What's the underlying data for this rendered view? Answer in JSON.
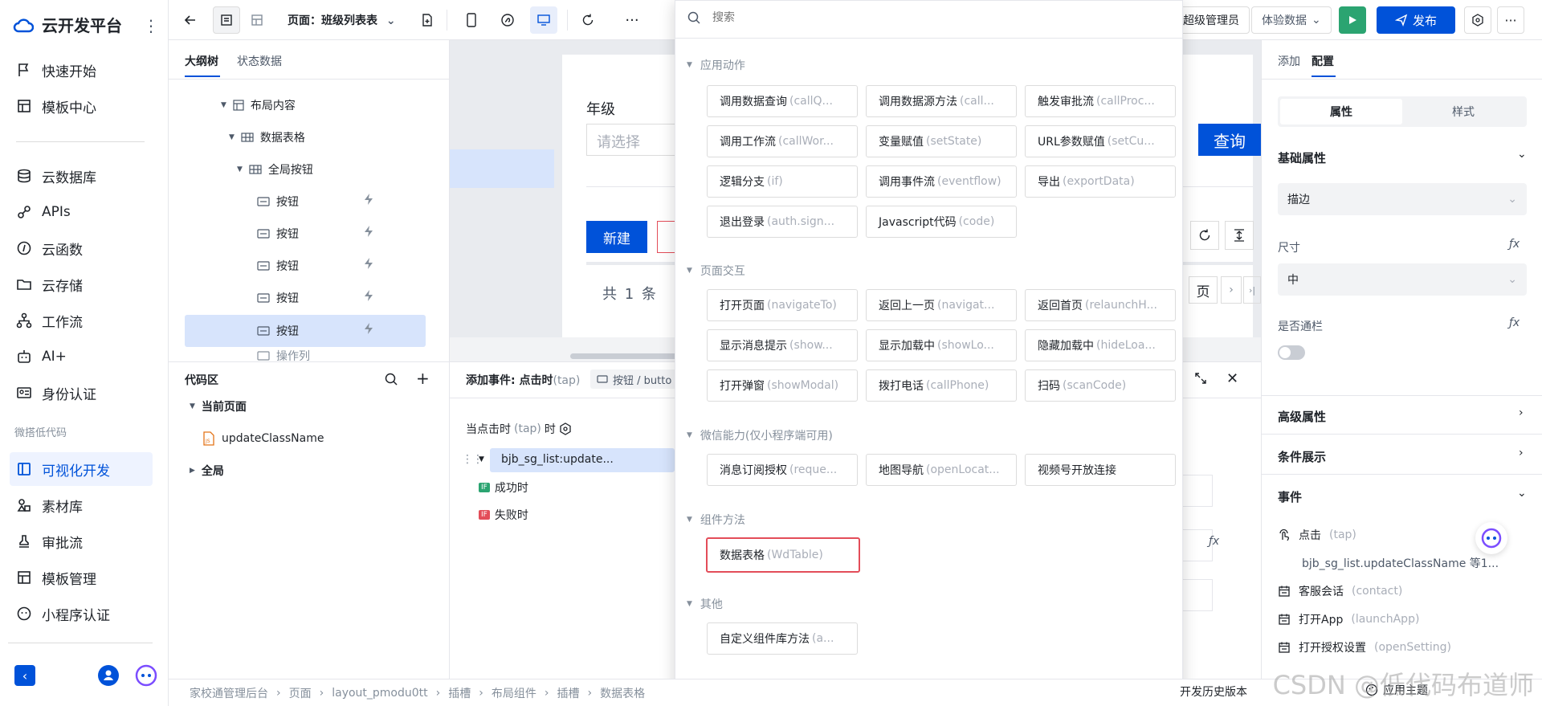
{
  "app": {
    "title": "云开发平台"
  },
  "sidebar": {
    "items": [
      {
        "label": "快速开始",
        "icon": "flag-icon"
      },
      {
        "label": "模板中心",
        "icon": "template-icon"
      },
      {
        "label": "云数据库",
        "icon": "database-icon"
      },
      {
        "label": "APIs",
        "icon": "api-icon"
      },
      {
        "label": "云函数",
        "icon": "function-icon"
      },
      {
        "label": "云存储",
        "icon": "folder-icon"
      },
      {
        "label": "工作流",
        "icon": "workflow-icon"
      },
      {
        "label": "AI+",
        "icon": "robot-icon"
      },
      {
        "label": "身份认证",
        "icon": "id-card-icon"
      }
    ],
    "section_label": "微搭低代码",
    "lowcode_items": [
      {
        "label": "可视化开发",
        "icon": "layout-icon",
        "active": true
      },
      {
        "label": "素材库",
        "icon": "shapes-icon"
      },
      {
        "label": "审批流",
        "icon": "stamp-icon"
      },
      {
        "label": "模板管理",
        "icon": "template-manage-icon"
      },
      {
        "label": "小程序认证",
        "icon": "miniprogram-icon"
      }
    ]
  },
  "toolbar": {
    "page_label": "页面：班级列表表",
    "role_label": "超级管理员",
    "data_label": "体验数据",
    "publish_label": "发布"
  },
  "tree": {
    "tabs": [
      "大纲树",
      "状态数据"
    ],
    "nodes": [
      {
        "label": "布局内容"
      },
      {
        "label": "数据表格"
      },
      {
        "label": "全局按钮"
      },
      {
        "label": "按钮"
      },
      {
        "label": "按钮"
      },
      {
        "label": "按钮"
      },
      {
        "label": "按钮"
      },
      {
        "label": "按钮",
        "selected": true
      },
      {
        "label": "操作列"
      }
    ]
  },
  "code": {
    "title": "代码区",
    "current_page": "当前页面",
    "file": "updateClassName",
    "global": "全局"
  },
  "canvas": {
    "grade_label": "年级",
    "grade_placeholder": "请选择",
    "query_label": "查询",
    "new_label": "新建",
    "total_text": "共 1 条",
    "page_label": "页"
  },
  "event": {
    "title_prefix": "添加事件: 点击时",
    "title_tap": "(tap)",
    "breadcrumb": "按钮 / butto",
    "trigger_prefix": "当点击时",
    "trigger_tap": "(tap)",
    "trigger_suffix": "时",
    "action": "bjb_sg_list:update...",
    "success": "成功时",
    "fail": "失败时",
    "if_label": "IF"
  },
  "dropdown": {
    "search_placeholder": "搜索",
    "groups": [
      {
        "title": "应用动作",
        "items": [
          {
            "main": "调用数据查询",
            "sub": "(callQ..."
          },
          {
            "main": "调用数据源方法",
            "sub": "(call..."
          },
          {
            "main": "触发审批流",
            "sub": "(callProc..."
          },
          {
            "main": "调用工作流",
            "sub": "(callWor..."
          },
          {
            "main": "变量赋值",
            "sub": "(setState)"
          },
          {
            "main": "URL参数赋值",
            "sub": "(setCu..."
          },
          {
            "main": "逻辑分支",
            "sub": "(if)"
          },
          {
            "main": "调用事件流",
            "sub": "(eventflow)"
          },
          {
            "main": "导出",
            "sub": "(exportData)"
          },
          {
            "main": "退出登录",
            "sub": "(auth.sign..."
          },
          {
            "main": "Javascript代码",
            "sub": "(code)"
          }
        ]
      },
      {
        "title": "页面交互",
        "items": [
          {
            "main": "打开页面",
            "sub": "(navigateTo)"
          },
          {
            "main": "返回上一页",
            "sub": "(navigat..."
          },
          {
            "main": "返回首页",
            "sub": "(relaunchH..."
          },
          {
            "main": "显示消息提示",
            "sub": "(show..."
          },
          {
            "main": "显示加载中",
            "sub": "(showLo..."
          },
          {
            "main": "隐藏加载中",
            "sub": "(hideLoa..."
          },
          {
            "main": "打开弹窗",
            "sub": "(showModal)"
          },
          {
            "main": "拨打电话",
            "sub": "(callPhone)"
          },
          {
            "main": "扫码",
            "sub": "(scanCode)"
          }
        ]
      },
      {
        "title": "微信能力(仅小程序端可用)",
        "items": [
          {
            "main": "消息订阅授权",
            "sub": "(reque..."
          },
          {
            "main": "地图导航",
            "sub": "(openLocat..."
          },
          {
            "main": "视频号开放连接",
            "sub": ""
          }
        ]
      },
      {
        "title": "组件方法",
        "items": [
          {
            "main": "数据表格",
            "sub": "(WdTable)",
            "highlight": true
          }
        ]
      },
      {
        "title": "其他",
        "items": [
          {
            "main": "自定义组件库方法",
            "sub": "(a..."
          }
        ]
      }
    ]
  },
  "right": {
    "tabs": [
      "添加",
      "配置"
    ],
    "seg": [
      "属性",
      "样式"
    ],
    "basic_title": "基础属性",
    "border_value": "描边",
    "size_label": "尺寸",
    "size_value": "中",
    "block_label": "是否通栏",
    "fx": "ƒx",
    "advanced": "高级属性",
    "condition": "条件展示",
    "events": "事件",
    "event_items": [
      {
        "main": "点击",
        "sub": "(tap)"
      },
      {
        "main": "客服会话",
        "sub": "(contact)"
      },
      {
        "main": "打开App",
        "sub": "(launchApp)"
      },
      {
        "main": "打开授权设置",
        "sub": "(openSetting)"
      }
    ],
    "tap_detail": "bjb_sg_list.updateClassName 等1..."
  },
  "footer": {
    "crumbs": [
      "家校通管理后台",
      "页面",
      "layout_pmodu0tt",
      "插槽",
      "布局组件",
      "插槽",
      "数据表格"
    ],
    "history": "开发历史版本",
    "theme": "应用主题"
  },
  "watermark": "CSDN @低代码布道师"
}
